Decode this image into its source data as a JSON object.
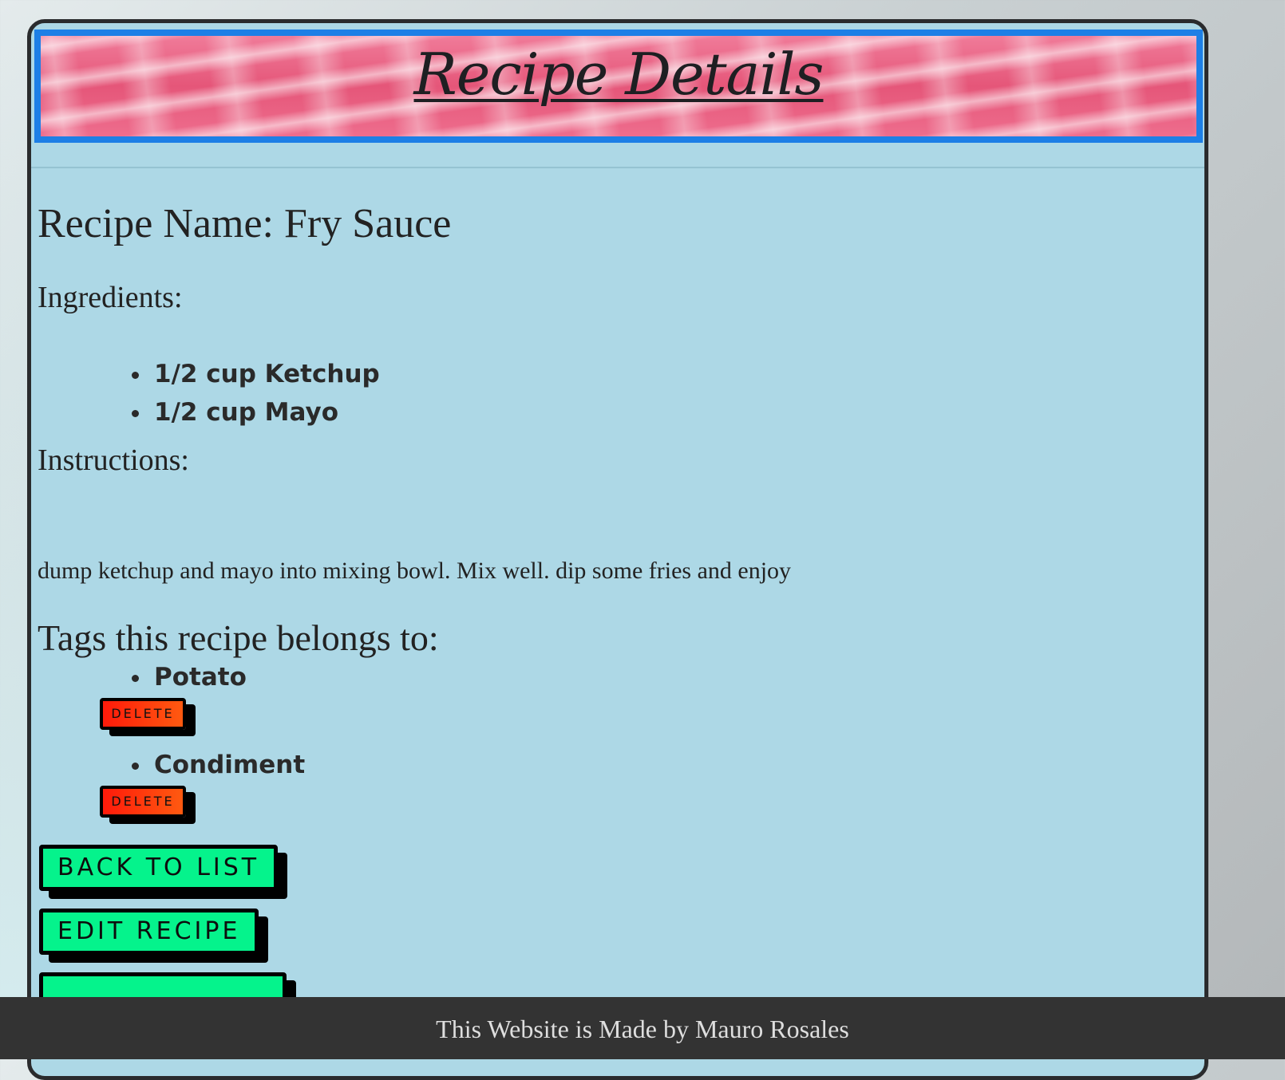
{
  "header": {
    "title": "Recipe Details"
  },
  "recipe": {
    "name_line": "Recipe Name: Fry Sauce",
    "ingredients_label": "Ingredients:",
    "ingredients": [
      "1/2 cup Ketchup",
      "1/2 cup Mayo"
    ],
    "instructions_label": "Instructions:",
    "instructions": "dump ketchup and mayo into mixing bowl. Mix well. dip some fries and enjoy",
    "tags_label": "Tags this recipe belongs to:",
    "tags": [
      {
        "name": "Potato",
        "delete_label": "DELETE"
      },
      {
        "name": "Condiment",
        "delete_label": "DELETE"
      }
    ]
  },
  "actions": {
    "back_label": "BACK TO LIST",
    "edit_label": "EDIT RECIPE"
  },
  "footer": {
    "text": "This Website is Made by Mauro Rosales"
  },
  "colors": {
    "panel_bg": "#add8e6",
    "banner_border": "#1d7fe6",
    "action_button": "#05f38c",
    "delete_button": "#ff2a0a",
    "footer_bg": "#333333"
  }
}
